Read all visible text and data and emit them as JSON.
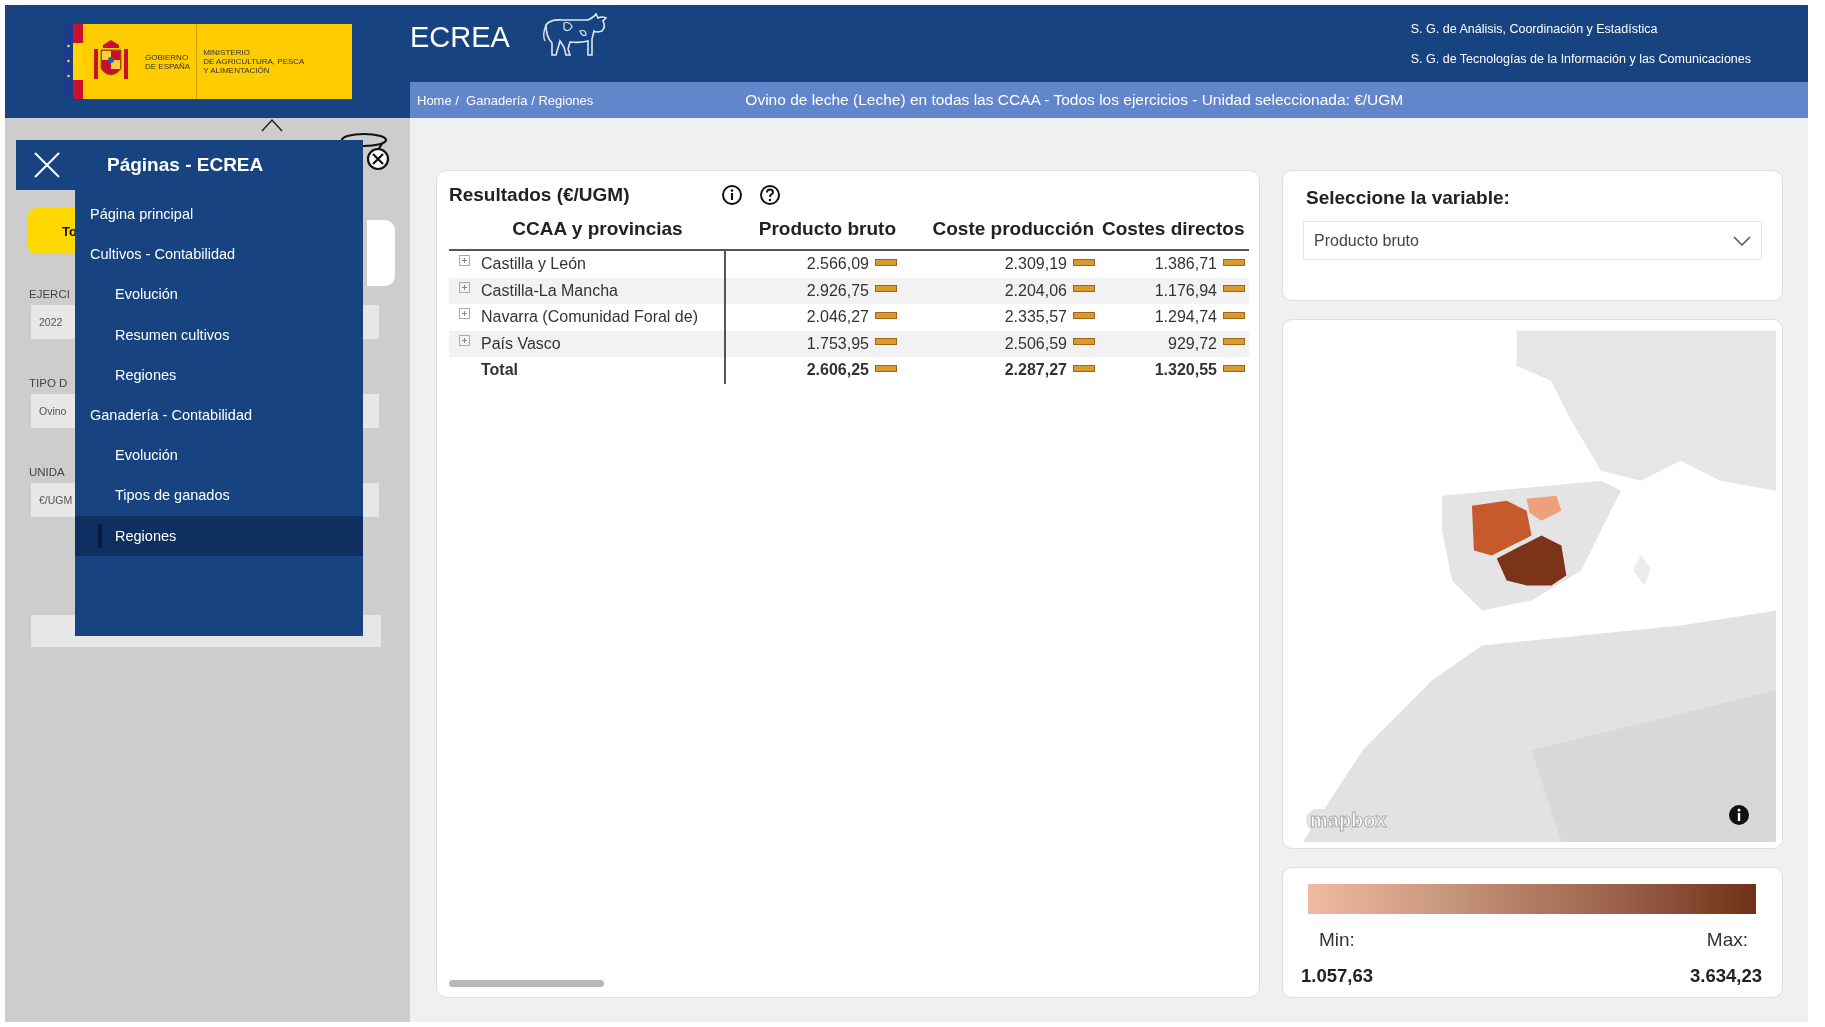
{
  "header": {
    "logo": {
      "government": [
        "GOBIERNO",
        "DE ESPAÑA"
      ],
      "ministry": [
        "MINISTERIO",
        "DE AGRICULTURA, PESCA",
        "Y ALIMENTACIÓN"
      ]
    },
    "app_title": "ECREA",
    "departments": [
      "S. G. de Análisis, Coordinación y Estadística",
      "S. G. de Tecnologías de la Información y las Comunicaciones"
    ],
    "breadcrumb": "Home /  Ganadería / Regiones",
    "context": "Ovino de leche (Leche) en todas las CCAA - Todos los ejercicios - Unidad seleccionada: €/UGM"
  },
  "filter_panel": {
    "button": "To",
    "fields": [
      {
        "label": "EJERCI",
        "value": "2022"
      },
      {
        "label": "TIPO D",
        "value": "Ovino"
      },
      {
        "label": "UNIDA",
        "value": "€/UGM"
      }
    ]
  },
  "nav_menu": {
    "title": "Páginas - ECREA",
    "items": [
      {
        "label": "Página principal",
        "selected": false
      },
      {
        "label": "Cultivos - Contabilidad",
        "selected": false,
        "children": [
          {
            "label": "Evolución",
            "selected": false
          },
          {
            "label": "Resumen cultivos",
            "selected": false
          },
          {
            "label": "Regiones",
            "selected": false
          }
        ]
      },
      {
        "label": "Ganadería - Contabilidad",
        "selected": false,
        "children": [
          {
            "label": "Evolución",
            "selected": false
          },
          {
            "label": "Tipos de ganados",
            "selected": false
          },
          {
            "label": "Regiones",
            "selected": true
          }
        ]
      }
    ]
  },
  "results_table": {
    "title": "Resultados (€/UGM)",
    "columns": [
      "CCAA y provincias",
      "Producto bruto",
      "Coste producción",
      "Costes directos"
    ],
    "rows": [
      {
        "kind": "group",
        "name": "Castilla y León",
        "values": [
          "2.566,09",
          "2.309,19",
          "1.386,71"
        ]
      },
      {
        "kind": "group",
        "name": "Castilla-La Mancha",
        "values": [
          "2.926,75",
          "2.204,06",
          "1.176,94"
        ]
      },
      {
        "kind": "group",
        "name": "Navarra (Comunidad Foral de)",
        "values": [
          "2.046,27",
          "2.335,57",
          "1.294,74"
        ]
      },
      {
        "kind": "group",
        "name": "País Vasco",
        "values": [
          "1.753,95",
          "2.506,59",
          "929,72"
        ]
      },
      {
        "kind": "total",
        "name": "Total",
        "values": [
          "2.606,25",
          "2.287,27",
          "1.320,55"
        ]
      }
    ]
  },
  "variable_selector": {
    "label": "Seleccione la variable:",
    "value": "Producto bruto"
  },
  "map": {
    "kind": "picture",
    "attribution": "mapbox"
  },
  "legend": {
    "min_label": "Min:",
    "max_label": "Max:",
    "min": "1.057,63",
    "max": "3.634,23"
  }
}
